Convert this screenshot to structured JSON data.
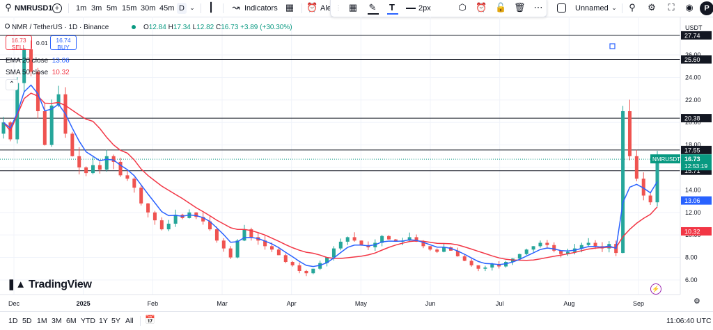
{
  "toolbar": {
    "symbol": "NMRUSD1",
    "intervals": [
      "1m",
      "3m",
      "5m",
      "15m",
      "30m",
      "45m",
      "D"
    ],
    "indicators_label": "Indicators",
    "alerts_label": "Ale",
    "line_width_label": "2px",
    "layout_name": "Unnamed",
    "avatar_letter": "P"
  },
  "legend": {
    "pair": "NMR / TetherUS · 1D · Binance",
    "ohlc": [
      {
        "k": "O",
        "v": "12.84"
      },
      {
        "k": "H",
        "v": "17.34"
      },
      {
        "k": "L",
        "v": "12.82"
      },
      {
        "k": "C",
        "v": "16.73"
      }
    ],
    "change": "+3.89 (+30.30%)",
    "sell_price": "16.73",
    "sell_label": "SELL",
    "spread": "0.01",
    "buy_price": "16.74",
    "buy_label": "BUY",
    "ema_name": "EMA 20 close",
    "ema_value": "13.06",
    "sma_name": "SMA 50 close",
    "sma_value": "10.32"
  },
  "colors": {
    "up": "#26a69a",
    "down": "#ef5350",
    "ema": "#2962ff",
    "sma": "#f23645",
    "hline": "#131722",
    "current_price": "#089981"
  },
  "chart_data": {
    "type": "candlestick",
    "symbol": "NMRUSDT",
    "currency": "USDT",
    "interval": "1D",
    "x_ticks": [
      "Dec",
      "2025",
      "Feb",
      "Mar",
      "Apr",
      "May",
      "Jun",
      "Jul",
      "Aug",
      "Sep"
    ],
    "y_ticks": [
      6.0,
      8.0,
      10.0,
      12.0,
      14.0,
      16.0,
      18.0,
      20.0,
      22.0,
      24.0,
      26.0
    ],
    "ylim": [
      4.7,
      29.4
    ],
    "horizontal_lines": [
      27.74,
      25.6,
      20.38,
      17.55,
      15.71
    ],
    "current_price": 16.73,
    "countdown": "12:53:19",
    "ema20_last": 13.06,
    "sma50_last": 10.32,
    "price_path": [
      {
        "month": "Dec",
        "values": [
          20.0,
          18.5,
          23.5,
          26.5,
          24.5,
          21.0,
          18.0,
          21.5,
          22.5,
          19.0
        ]
      },
      {
        "month": "2025",
        "values": [
          17.0,
          16.0,
          15.5,
          16.2,
          15.8,
          17.0,
          16.5,
          15.3,
          15.0,
          14.2
        ]
      },
      {
        "month": "Feb",
        "values": [
          12.8,
          12.0,
          11.3,
          10.5,
          11.0,
          11.8,
          11.5,
          12.0,
          11.6,
          11.2
        ]
      },
      {
        "month": "Mar",
        "values": [
          10.5,
          9.5,
          8.8,
          8.0,
          9.5,
          10.5,
          9.8,
          9.5,
          9.0,
          8.7
        ]
      },
      {
        "month": "Apr",
        "values": [
          8.2,
          7.6,
          7.3,
          6.8,
          6.6,
          7.0,
          7.5,
          8.0,
          8.8,
          9.4
        ]
      },
      {
        "month": "May",
        "values": [
          9.8,
          9.5,
          9.1,
          8.9,
          9.3,
          9.9,
          9.6,
          9.4,
          9.5,
          9.8
        ]
      },
      {
        "month": "Jun",
        "values": [
          9.4,
          9.0,
          8.7,
          8.5,
          8.9,
          8.6,
          8.1,
          7.7,
          7.3,
          7.0
        ]
      },
      {
        "month": "Jul",
        "values": [
          7.1,
          7.4,
          7.2,
          7.6,
          7.9,
          8.3,
          8.7,
          9.0,
          9.3,
          9.1
        ]
      },
      {
        "month": "Aug",
        "values": [
          8.6,
          8.3,
          8.5,
          8.8,
          9.1,
          9.3,
          9.0,
          8.8,
          9.2,
          8.4
        ]
      },
      {
        "month": "Sep",
        "values": [
          21.0,
          17.0,
          15.0,
          13.5,
          12.9,
          16.73
        ]
      }
    ]
  },
  "bottom": {
    "ranges": [
      "1D",
      "5D",
      "1M",
      "3M",
      "6M",
      "YTD",
      "1Y",
      "5Y",
      "All"
    ],
    "time": "11:06:40 UTC"
  },
  "watermark": "TradingView"
}
